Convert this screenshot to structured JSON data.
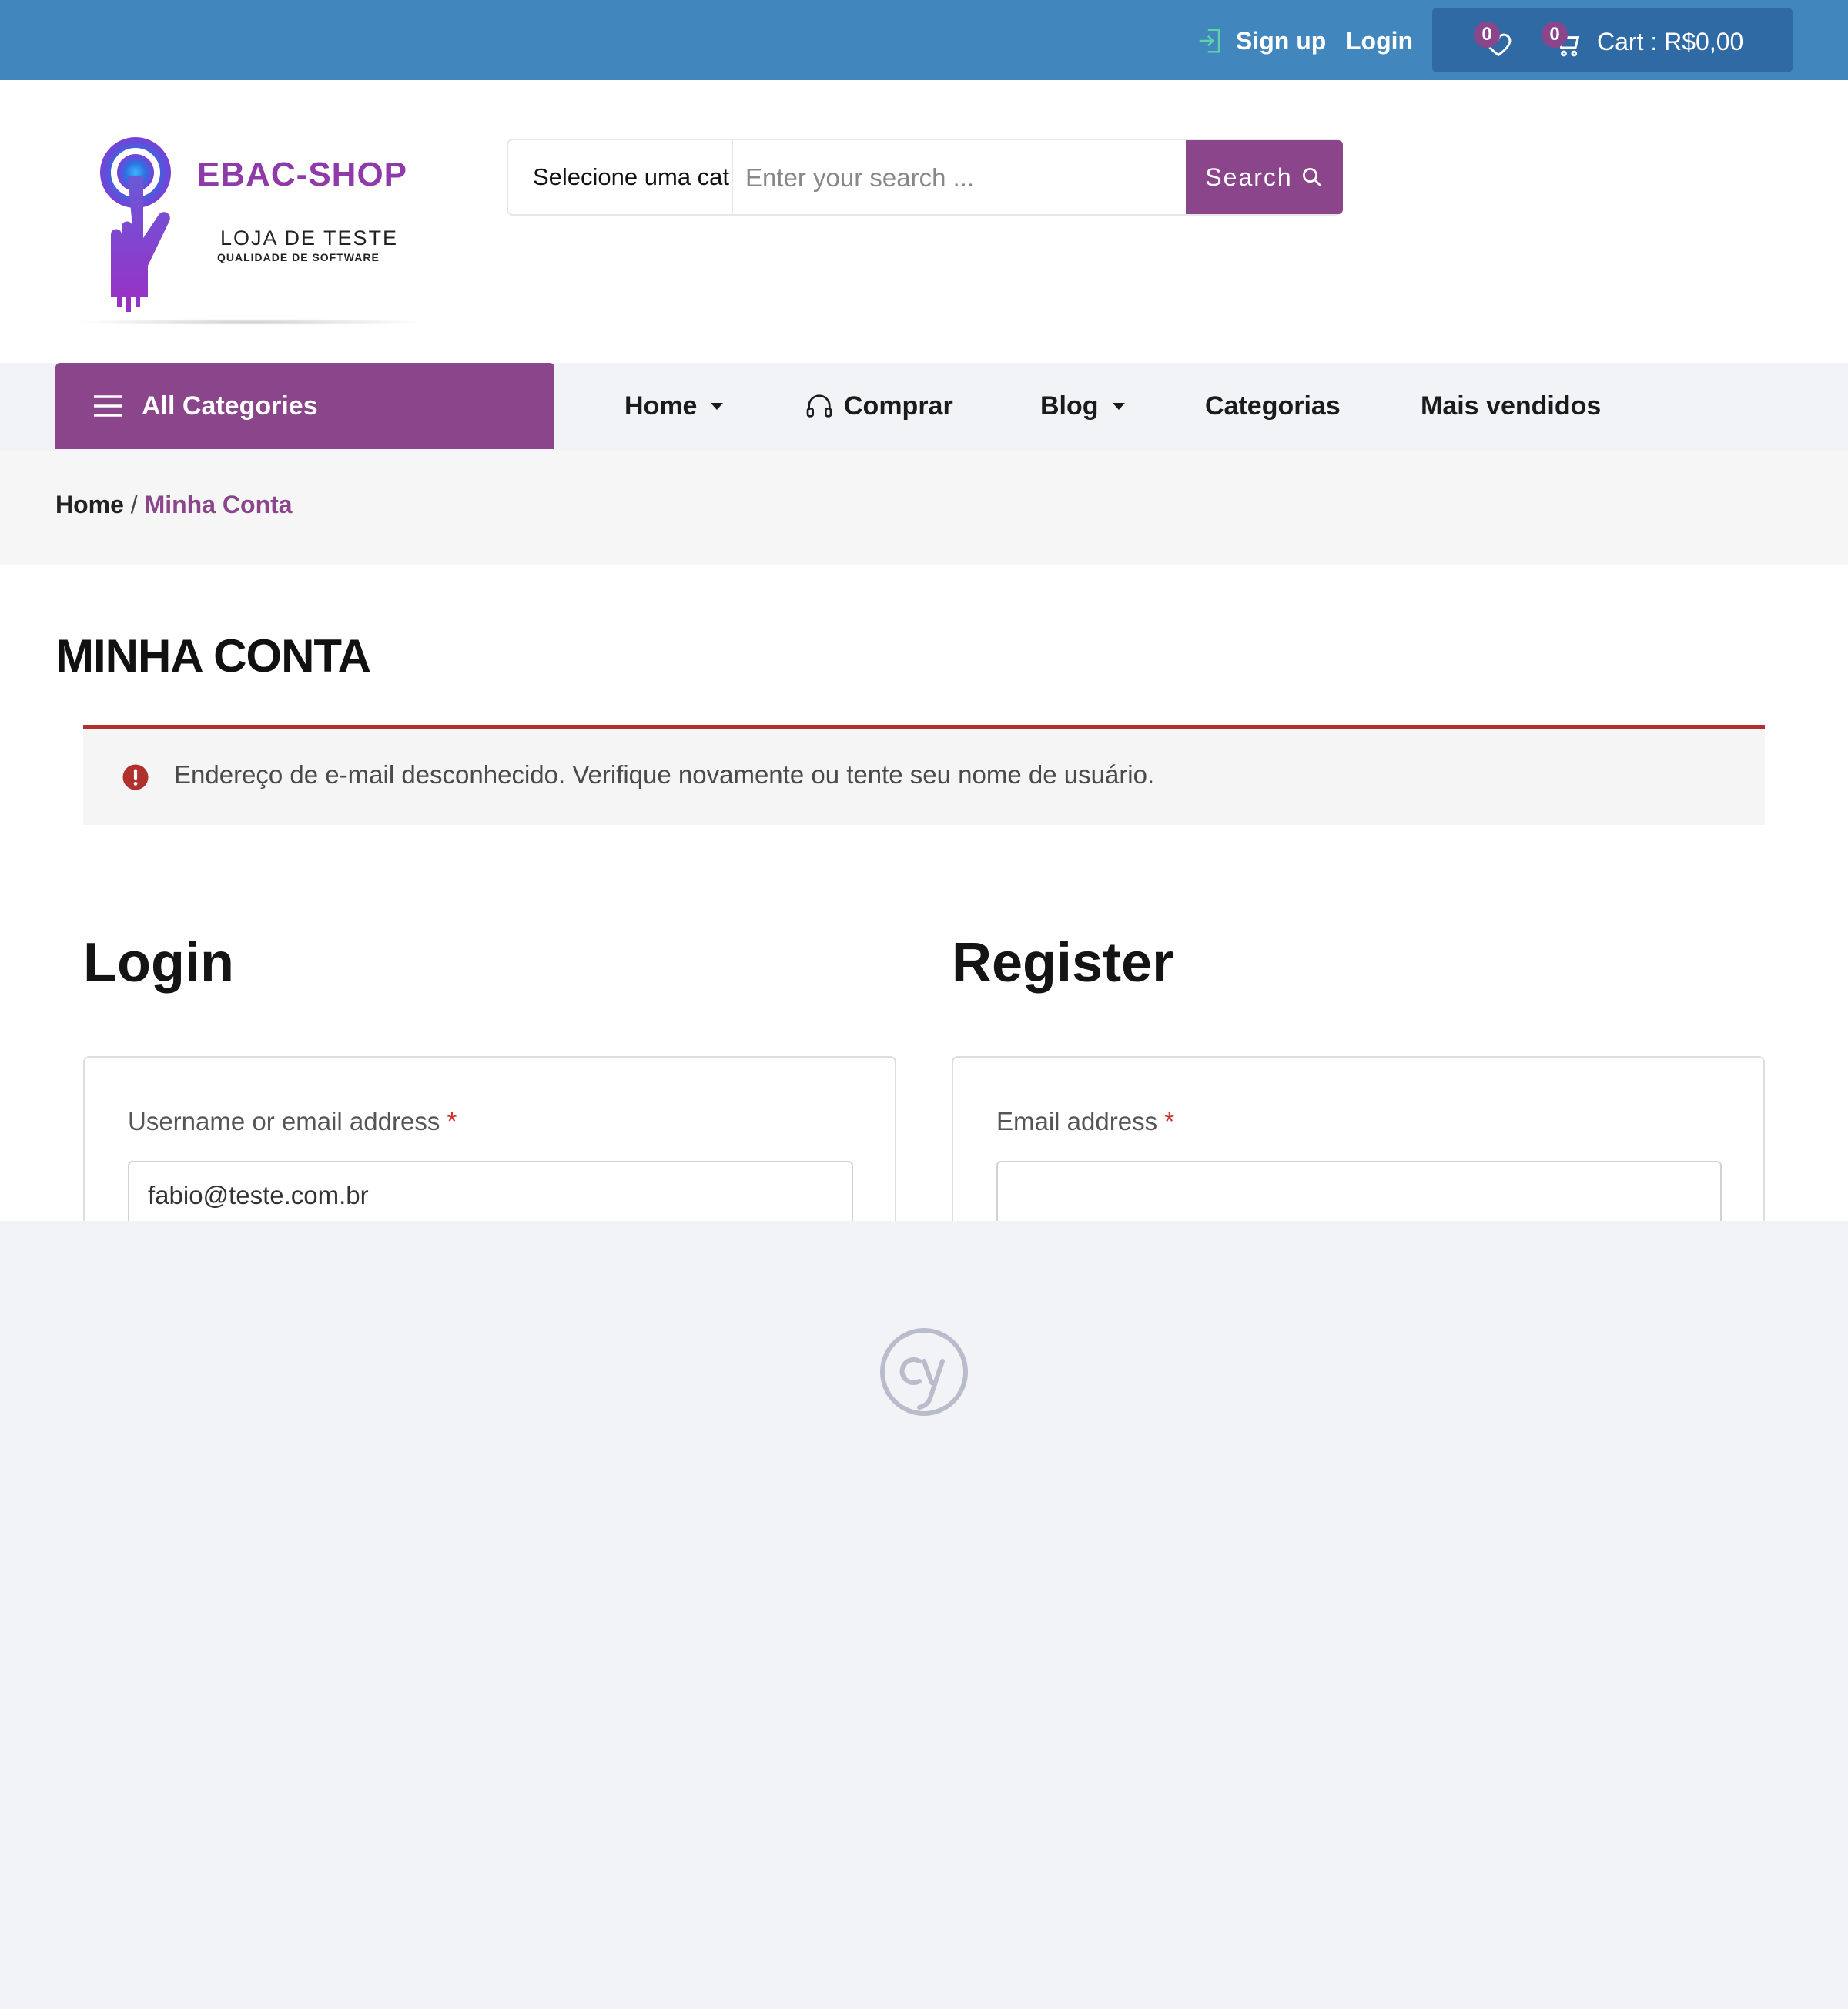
{
  "topbar": {
    "signup_label": "Sign up",
    "login_label": "Login",
    "wishlist_count": "0",
    "cart_count": "0",
    "cart_label": "Cart : R$0,00"
  },
  "brand": {
    "title": "EBAC-SHOP",
    "subtitle": "LOJA DE TESTE",
    "tagline": "QUALIDADE DE SOFTWARE"
  },
  "search": {
    "category": "Selecione uma cat",
    "placeholder": "Enter your search ...",
    "button_label": "Search"
  },
  "nav": {
    "all_categories": "All Categories",
    "items": [
      {
        "label": "Home"
      },
      {
        "label": "Comprar"
      },
      {
        "label": "Blog"
      },
      {
        "label": "Categorias"
      },
      {
        "label": "Mais vendidos"
      }
    ]
  },
  "breadcrumb": {
    "home": "Home",
    "separator": "/",
    "current": "Minha Conta"
  },
  "page": {
    "title": "MINHA CONTA",
    "error_message": "Endereço de e-mail desconhecido. Verifique novamente ou tente seu nome de usuário."
  },
  "login": {
    "heading": "Login",
    "username_label": "Username or email address",
    "required_mark": "*",
    "username_value": "fabio@teste.com.br"
  },
  "register": {
    "heading": "Register",
    "email_label": "Email address",
    "required_mark": "*",
    "email_value": ""
  },
  "colors": {
    "topbar": "#4187be",
    "cart_box": "#2f6aa4",
    "accent_purple": "#8a458b",
    "error_red": "#b0302d",
    "background": "#f2f3f7"
  },
  "icons": [
    "signup-icon",
    "heart-icon",
    "cart-icon",
    "search-icon",
    "hamburger-icon",
    "headphones-icon",
    "chevron-down-icon",
    "error-icon",
    "cypress-logo-icon"
  ]
}
